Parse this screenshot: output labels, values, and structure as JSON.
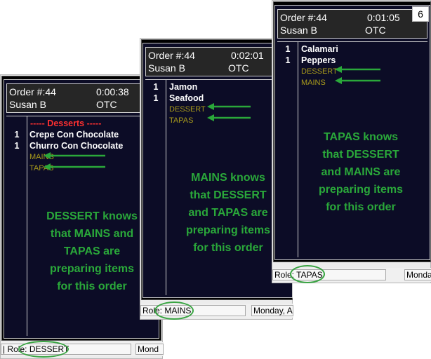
{
  "screens": [
    {
      "id": "dessert",
      "order_label": "Order #:44",
      "timer": "0:00:38",
      "server": "Susan B",
      "order_type": "OTC",
      "category_header": "----- Desserts -----",
      "items": [
        {
          "qty": "1",
          "name": "Crepe Con Chocolate"
        },
        {
          "qty": "1",
          "name": "Churro Con Chocolate"
        }
      ],
      "stations": [
        "MAINS",
        "TAPAS"
      ],
      "note_lines": [
        "DESSERT knows",
        "that MAINS and",
        "TAPAS are",
        "preparing items",
        "for this order"
      ],
      "status_prefix": "| Role: ",
      "role": "DESSERT",
      "status_date": "Mond"
    },
    {
      "id": "mains",
      "order_label": "Order #:44",
      "timer": "0:02:01",
      "server": "Susan B",
      "order_type": "OTC",
      "items": [
        {
          "qty": "1",
          "name": "Jamon"
        },
        {
          "qty": "1",
          "name": "Seafood"
        }
      ],
      "stations": [
        "DESSERT",
        "TAPAS"
      ],
      "note_lines": [
        "MAINS knows",
        "that DESSERT",
        "and TAPAS are",
        "preparing items",
        "for this order"
      ],
      "status_prefix": "Role: ",
      "role": "MAINS",
      "status_date": "Monday, A"
    },
    {
      "id": "tapas",
      "order_label": "Order #:44",
      "timer": "0:01:05",
      "server": "Susan B",
      "order_type": "OTC",
      "badge": "6",
      "items": [
        {
          "qty": "1",
          "name": "Calamari"
        },
        {
          "qty": "1",
          "name": "Peppers"
        }
      ],
      "stations": [
        "DESSERT",
        "MAINS"
      ],
      "note_lines": [
        "TAPAS knows",
        "that DESSERT",
        "and MAINS are",
        "preparing items",
        "for this order"
      ],
      "status_prefix": "Role: ",
      "role": "TAPAS",
      "status_date": "Monda"
    }
  ],
  "colors": {
    "note_green": "#2aa83a",
    "station_text": "#a89a1c",
    "category_red": "#ff3030",
    "ticket_bg": "#0c0c26"
  },
  "icons": [
    "green-arrow-left-icon",
    "green-ellipse-highlight"
  ]
}
